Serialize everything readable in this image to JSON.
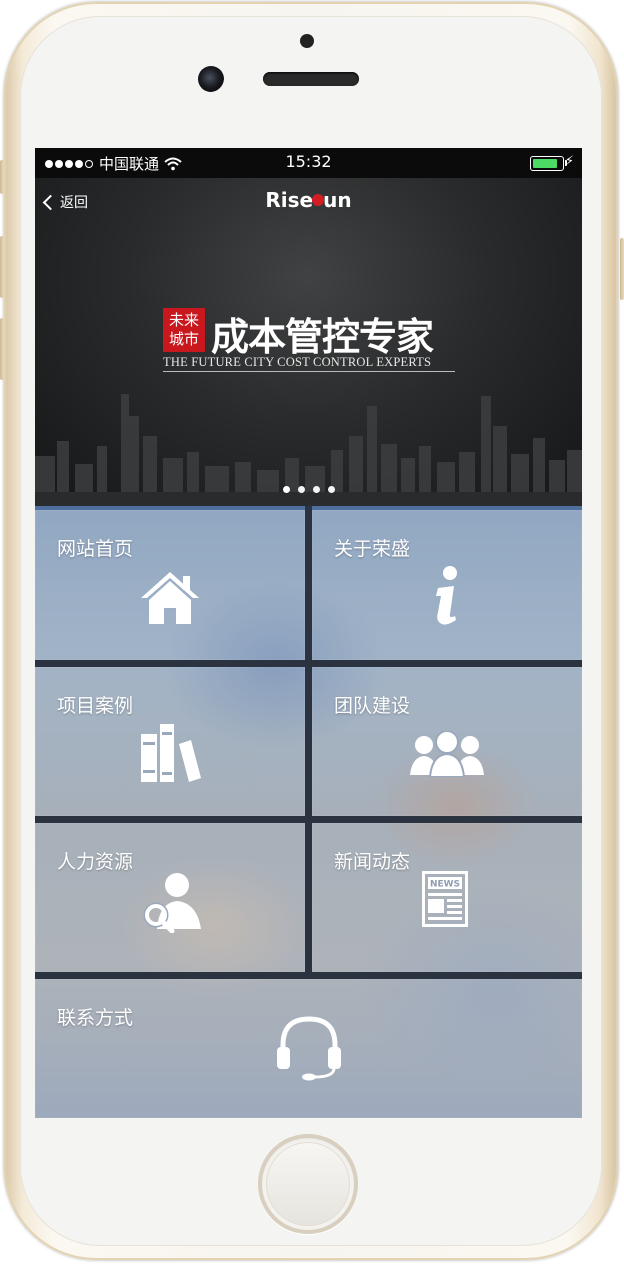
{
  "status_bar": {
    "carrier": "中国联通",
    "time": "15:32",
    "battery_level": 0.9
  },
  "nav": {
    "back_label": "返回",
    "brand_left": "Rise",
    "brand_right": "un"
  },
  "banner": {
    "seal_line1": "未来",
    "seal_line2": "城市",
    "title": "成本管控专家",
    "subtitle": "THE FUTURE CITY COST CONTROL EXPERTS",
    "page_count": 4,
    "active_page": 1
  },
  "menu": {
    "items": [
      {
        "label": "网站首页",
        "icon": "home-icon"
      },
      {
        "label": "关于荣盛",
        "icon": "info-icon"
      },
      {
        "label": "项目案例",
        "icon": "books-icon"
      },
      {
        "label": "团队建设",
        "icon": "team-icon"
      },
      {
        "label": "人力资源",
        "icon": "user-search-icon"
      },
      {
        "label": "新闻动态",
        "icon": "news-icon"
      },
      {
        "label": "联系方式",
        "icon": "headset-icon"
      }
    ],
    "news_icon_text": "NEWS"
  },
  "colors": {
    "accent_red": "#c9171e",
    "battery_green": "#4cd964",
    "frame_gold": "#e3d3b3"
  }
}
